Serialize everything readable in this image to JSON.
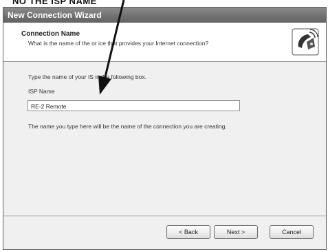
{
  "annotation": {
    "label": "NO THE  ISP NAME"
  },
  "window": {
    "title": "New Connection Wizard"
  },
  "header": {
    "heading": "Connection Name",
    "subheading": "What is the name of the or    ice that provides your Internet connection?"
  },
  "body": {
    "instruction": "Type the name of your IS   in the following box.",
    "isp_label": "ISP Name",
    "isp_value": "RE-2 Remote",
    "note": "The name you type here will be the name of the connection you are creating."
  },
  "buttons": {
    "back": "< Back",
    "next": "Next >",
    "cancel": "Cancel"
  },
  "icons": {
    "wizard": "phone-modem-icon",
    "arrow": "annotation-arrow"
  }
}
